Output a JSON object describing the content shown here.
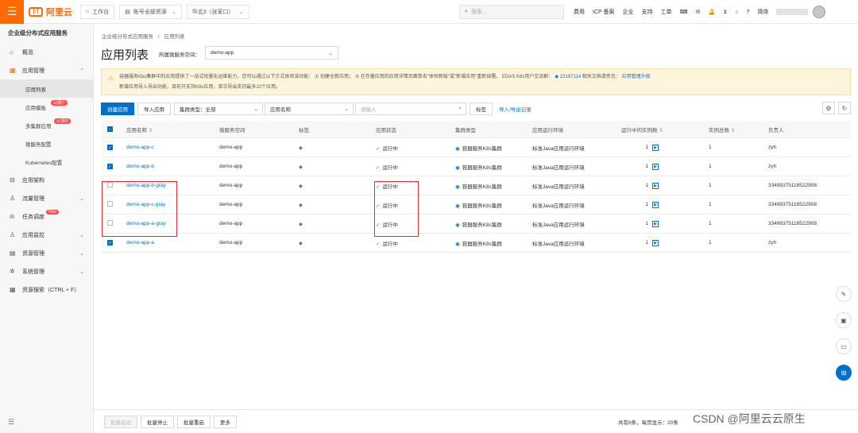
{
  "topbar": {
    "logo_text": "阿里云",
    "workbench": "工作台",
    "account_resources": "账号全部资源",
    "region": "华北3（张家口）",
    "search_placeholder": "搜索...",
    "links": [
      "费用",
      "ICP 备案",
      "企业",
      "支持",
      "工单"
    ],
    "lang": "简体"
  },
  "sidebar": {
    "title": "企业级分布式应用服务",
    "items": [
      {
        "label": "概览",
        "icon": "home-icon"
      },
      {
        "label": "应用管理",
        "icon": "grid-icon"
      },
      {
        "label": "应用列表"
      },
      {
        "label": "应用模板",
        "badge": "公测中"
      },
      {
        "label": "多集群应用",
        "badge": "公测中"
      },
      {
        "label": "微服务配置"
      },
      {
        "label": "Kubernetes配置"
      },
      {
        "label": "应用架构",
        "icon": "architecture-icon"
      },
      {
        "label": "流量管理",
        "icon": "traffic-icon"
      },
      {
        "label": "任务调度",
        "badge": "New"
      },
      {
        "label": "应用监控",
        "icon": "monitor-icon"
      },
      {
        "label": "资源管理",
        "icon": "resource-icon"
      },
      {
        "label": "系统管理",
        "icon": "gear-icon"
      },
      {
        "label": "资源搜索（CTRL + F）",
        "icon": "search-icon"
      }
    ]
  },
  "main": {
    "breadcrumb": [
      "企业级分布式应用服务",
      "/",
      "应用列表"
    ],
    "title": "应用列表",
    "ns_label": "所属微服务空间：",
    "ns_value": "demo-app",
    "notice_line1": "容器服务Kbs集群中的应用提供了一站式轻量化运维能力，您可以通过以下方式体验该功能： ① 创建全新应用； ② 在存量应用的应用详情页面单击\"体验新版\"或\"新增应用\"重新部署。 EDAS K8s用户交流群：",
    "notice_group": "23197114",
    "notice_tail": "相关文档请参见：",
    "notice_link": "应用管理升级",
    "notice_line2": "新增应用导入导出功能，目前只支持K8s应用，单次导出支持最多10个应用。",
    "toolbar": {
      "create": "创建应用",
      "import": "导入应用",
      "cluster_type": "集群类型：全部",
      "app_name": "应用名称",
      "search_placeholder": "请输入",
      "tag": "标签",
      "import_export": "导入/导出记录"
    },
    "columns": [
      "应用名称",
      "微服务空间",
      "标签",
      "应用状态",
      "集群类型",
      "应用运行环境",
      "运行中的实例数",
      "实例总数",
      "负责人"
    ],
    "rows": [
      {
        "name": "demo-app-c",
        "ns": "demo-app",
        "status": "运行中",
        "cluster": "容器服务K8s集群",
        "env": "标准Java应用运行环境",
        "running": "1",
        "total": "1",
        "owner": "zyh",
        "checked": true
      },
      {
        "name": "demo-app-b",
        "ns": "demo-app",
        "status": "运行中",
        "cluster": "容器服务K8s集群",
        "env": "标准Java应用运行环境",
        "running": "1",
        "total": "1",
        "owner": "zyh",
        "checked": true
      },
      {
        "name": "demo-app-b-gray",
        "ns": "demo-app",
        "status": "运行中",
        "cluster": "容器服务K8s集群",
        "env": "标准Java应用运行环境",
        "running": "1",
        "total": "1",
        "owner": "33499375118522908",
        "checked": false
      },
      {
        "name": "demo-app-c-gray",
        "ns": "demo-app",
        "status": "运行中",
        "cluster": "容器服务K8s集群",
        "env": "标准Java应用运行环境",
        "running": "1",
        "total": "1",
        "owner": "33499375118522908",
        "checked": false
      },
      {
        "name": "demo-app-a-gray",
        "ns": "demo-app",
        "status": "运行中",
        "cluster": "容器服务K8s集群",
        "env": "标准Java应用运行环境",
        "running": "1",
        "total": "1",
        "owner": "33499375118522908",
        "checked": false
      },
      {
        "name": "demo-app-a",
        "ns": "demo-app",
        "status": "运行中",
        "cluster": "容器服务K8s集群",
        "env": "标准Java应用运行环境",
        "running": "1",
        "total": "1",
        "owner": "zyh",
        "checked": true
      }
    ]
  },
  "bottom": {
    "buttons": [
      "批量启动",
      "批量停止",
      "批量重启",
      "更多"
    ],
    "pager": "共有6条，每页显示：20条"
  },
  "watermark": "CSDN @阿里云云原生",
  "accent": "#0070cc",
  "brand": "#ff6a00"
}
